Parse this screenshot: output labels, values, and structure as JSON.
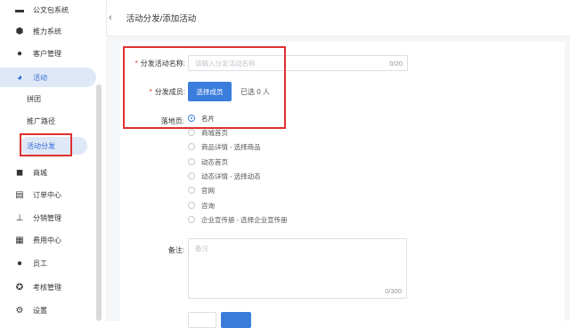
{
  "sidebar": {
    "items": [
      {
        "label": "公文包系统",
        "icon": "briefcase-icon"
      },
      {
        "label": "推力系统",
        "icon": "hexagon-icon"
      },
      {
        "label": "客户管理",
        "icon": "user-icon"
      },
      {
        "label": "活动",
        "icon": "pie-chart-icon"
      },
      {
        "label": "商城",
        "icon": "shopping-bag-icon"
      },
      {
        "label": "订单中心",
        "icon": "clipboard-icon"
      },
      {
        "label": "分销管理",
        "icon": "hierarchy-icon"
      },
      {
        "label": "费用中心",
        "icon": "store-icon"
      },
      {
        "label": "员工",
        "icon": "person-icon"
      },
      {
        "label": "考核管理",
        "icon": "badge-icon"
      },
      {
        "label": "设置",
        "icon": "gear-icon"
      }
    ],
    "sub_items": [
      {
        "label": "拼团"
      },
      {
        "label": "推广路径"
      },
      {
        "label": "活动分发"
      }
    ]
  },
  "header": {
    "breadcrumb": "活动分发/添加活动"
  },
  "form": {
    "name_label": "分发活动名称:",
    "name_placeholder": "请输入分发活动名称",
    "name_count": "0/20",
    "members_label": "分发成员:",
    "select_members_button": "选择成员",
    "selected_count": "已选 0 人",
    "landing_label": "落地页:",
    "landing_options": [
      "名片",
      "商城首页",
      "商品详情 - 选择商品",
      "动态首页",
      "动态详情 - 选择动态",
      "官网",
      "咨询",
      "企业宣传册 - 选择企业宣传册"
    ],
    "remark_label": "备注:",
    "remark_placeholder": "备注",
    "remark_count": "0/300"
  },
  "colors": {
    "accent": "#3a7ddd",
    "highlight": "#e03030",
    "active_bg": "#dfe8f6"
  }
}
